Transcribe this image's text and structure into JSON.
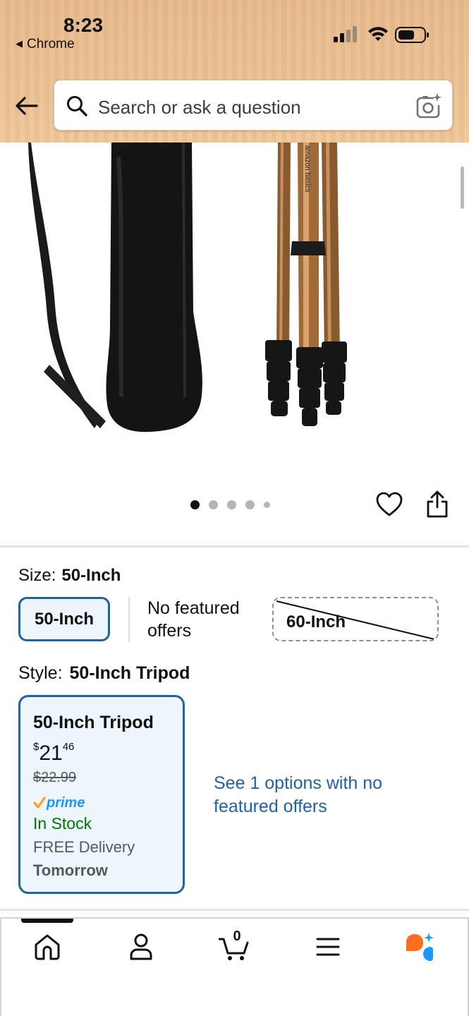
{
  "status_bar": {
    "time": "8:23",
    "back_app": "Chrome"
  },
  "search": {
    "placeholder": "Search or ask a question"
  },
  "product_image": {
    "brand_print": "amazon basics",
    "carousel_total": 5,
    "carousel_active": 1
  },
  "size": {
    "label": "Size:",
    "value": "50-Inch",
    "options": [
      {
        "label": "50-Inch",
        "state": "selected"
      },
      {
        "label": "No featured offers",
        "state": "info"
      },
      {
        "label": "60-Inch",
        "state": "unavailable"
      }
    ]
  },
  "style": {
    "label": "Style:",
    "value": "50-Inch Tripod",
    "card": {
      "title": "50-Inch Tripod",
      "price_symbol": "$",
      "price_whole": "21",
      "price_fraction": "46",
      "list_price": "$22.99",
      "prime": "prime",
      "availability": "In Stock",
      "delivery": "FREE Delivery",
      "delivery_day": "Tomorrow"
    },
    "see_options": "See 1 options with no featured offers"
  },
  "bottom_nav": {
    "items": [
      "home-icon",
      "account-icon",
      "cart-icon",
      "menu-icon",
      "rufus-icon"
    ],
    "cart_count": "0",
    "active": "home"
  },
  "colors": {
    "header_bg": "#efc697",
    "accent_blue": "#2162a1",
    "selected_bg": "#edf6fd",
    "in_stock": "#007600",
    "prime_blue": "#1a98ff",
    "rufus_orange": "#ff6d1f",
    "rufus_blue": "#1a98ff"
  }
}
